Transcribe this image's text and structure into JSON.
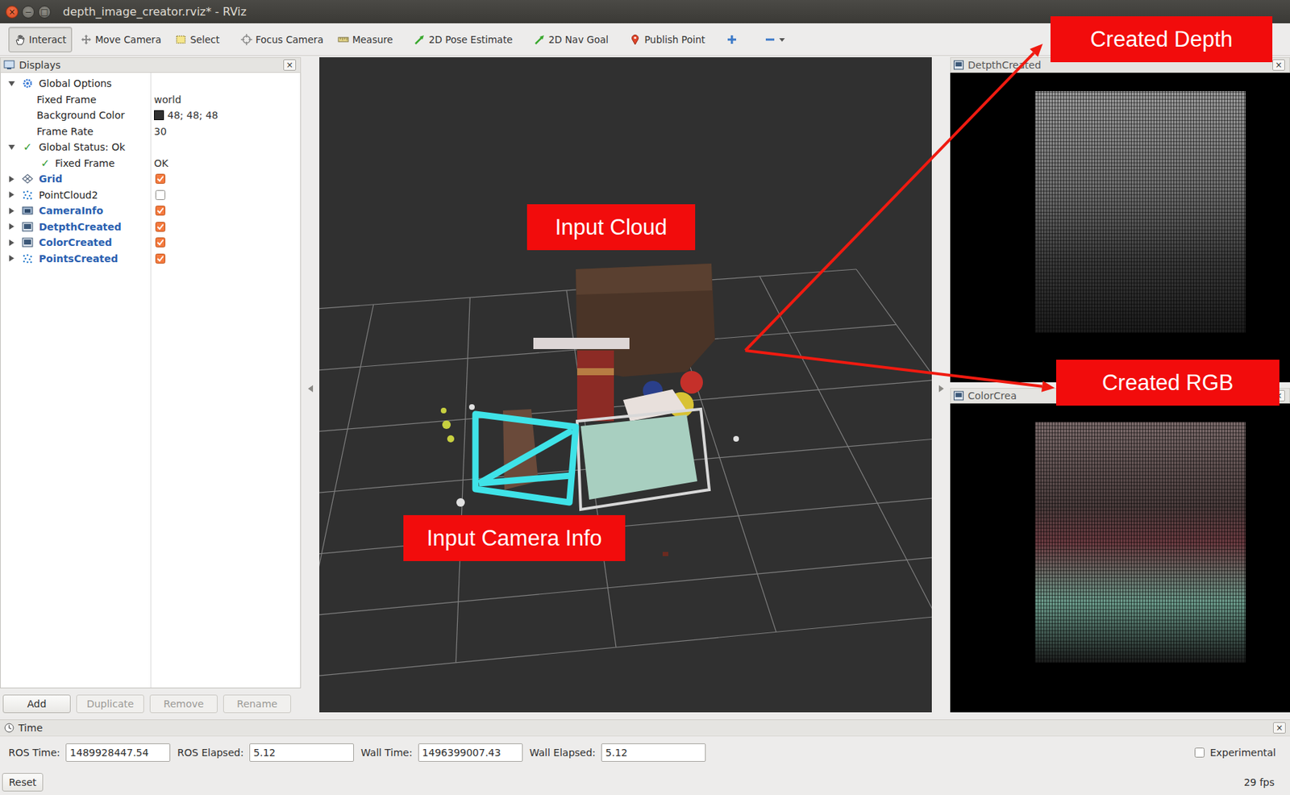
{
  "window": {
    "title": "depth_image_creator.rviz* - RViz",
    "controls": [
      "×",
      "−",
      "□"
    ]
  },
  "toolbar": {
    "tools": [
      {
        "label": "Interact",
        "selected": true
      },
      {
        "label": "Move Camera",
        "selected": false
      },
      {
        "label": "Select",
        "selected": false
      },
      {
        "label": "Focus Camera",
        "selected": false
      },
      {
        "label": "Measure",
        "selected": false
      },
      {
        "label": "2D Pose Estimate",
        "selected": false
      },
      {
        "label": "2D Nav Goal",
        "selected": false
      },
      {
        "label": "Publish Point",
        "selected": false
      }
    ]
  },
  "displays": {
    "title": "Displays",
    "close": "×",
    "rows": [
      {
        "kind": "options",
        "label": "Global Options",
        "expanded": true
      },
      {
        "kind": "property",
        "label": "Fixed Frame",
        "value": "world"
      },
      {
        "kind": "property",
        "label": "Background Color",
        "value": "48; 48; 48",
        "color": "#303030"
      },
      {
        "kind": "property",
        "label": "Frame Rate",
        "value": "30"
      },
      {
        "kind": "status",
        "label": "Global Status: Ok",
        "icon": "✓",
        "expanded": true
      },
      {
        "kind": "check",
        "label": "Fixed Frame",
        "icon": "✓",
        "value": "OK"
      },
      {
        "kind": "grid",
        "label": "Grid",
        "expanded": false,
        "checked": true
      },
      {
        "kind": "cloud",
        "label": "PointCloud2",
        "expanded": false,
        "checked": false
      },
      {
        "kind": "camera",
        "label": "CameraInfo",
        "expanded": false,
        "checked": true
      },
      {
        "kind": "image",
        "label": "DetpthCreated",
        "expanded": false,
        "checked": true
      },
      {
        "kind": "image",
        "label": "ColorCreated",
        "expanded": false,
        "checked": true
      },
      {
        "kind": "cloud",
        "label": "PointsCreated",
        "expanded": false,
        "checked": true
      }
    ],
    "buttons": [
      {
        "label": "Add",
        "disabled": false
      },
      {
        "label": "Duplicate",
        "disabled": true
      },
      {
        "label": "Remove",
        "disabled": true
      },
      {
        "label": "Rename",
        "disabled": true
      }
    ]
  },
  "image_panels": [
    {
      "title": "DetpthCreated",
      "close": "×"
    },
    {
      "title": "ColorCrea",
      "close": "×"
    }
  ],
  "annotations": [
    {
      "label": "Created Depth"
    },
    {
      "label": "Input Cloud"
    },
    {
      "label": "Created RGB"
    },
    {
      "label": "Input Camera Info"
    }
  ],
  "time": {
    "title": "Time",
    "close": "×",
    "fields": [
      {
        "label": "ROS Time:",
        "value": "1489928447.54"
      },
      {
        "label": "ROS Elapsed:",
        "value": "5.12"
      },
      {
        "label": "Wall Time:",
        "value": "1496399007.43"
      },
      {
        "label": "Wall Elapsed:",
        "value": "5.12"
      }
    ],
    "experimental": {
      "label": "Experimental",
      "checked": false
    }
  },
  "status_bar": {
    "reset": "Reset",
    "fps": "29 fps"
  }
}
